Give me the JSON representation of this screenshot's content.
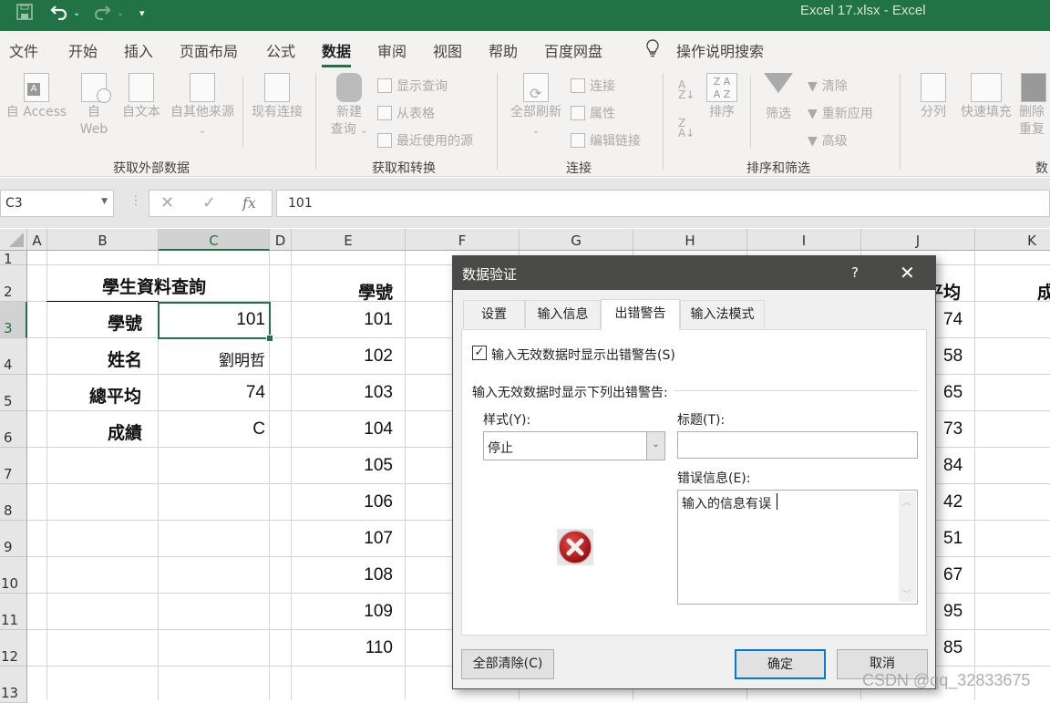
{
  "window": {
    "title": "Excel 17.xlsx  -  Excel"
  },
  "quick_access": {
    "save_icon": "save-icon",
    "undo_icon": "undo-icon",
    "redo_icon": "redo-icon",
    "customize_icon": "customize-qat-icon"
  },
  "ribbon_tabs": [
    {
      "label": "文件"
    },
    {
      "label": "开始"
    },
    {
      "label": "插入"
    },
    {
      "label": "页面布局"
    },
    {
      "label": "公式"
    },
    {
      "label": "数据",
      "active": true
    },
    {
      "label": "审阅"
    },
    {
      "label": "视图"
    },
    {
      "label": "帮助"
    },
    {
      "label": "百度网盘"
    }
  ],
  "tell_me": {
    "label": "操作说明搜索"
  },
  "ribbon": {
    "groups": [
      {
        "label": "获取外部数据",
        "buttons": [
          "自 Access",
          "自",
          "Web",
          "自文本",
          "自其他来源",
          "现有连接"
        ]
      },
      {
        "label": "获取和转换",
        "buttons": [
          "新建",
          "查询",
          "显示查询",
          "从表格",
          "最近使用的源"
        ]
      },
      {
        "label": "连接",
        "buttons": [
          "全部刷新",
          "连接",
          "属性",
          "编辑链接"
        ]
      },
      {
        "label": "排序和筛选",
        "buttons": [
          "排序",
          "筛选",
          "清除",
          "重新应用",
          "高级"
        ]
      },
      {
        "label": "数",
        "buttons": [
          "分列",
          "快速填充",
          "删除",
          "重复"
        ]
      }
    ]
  },
  "formula_bar": {
    "name_box": "C3",
    "value": "101",
    "fx": "fx"
  },
  "columns": [
    "A",
    "B",
    "C",
    "D",
    "E",
    "F",
    "G",
    "H",
    "I",
    "J",
    "K"
  ],
  "rows": [
    "1",
    "2",
    "3",
    "4",
    "5",
    "6",
    "7",
    "8",
    "9",
    "10",
    "11",
    "12",
    "13"
  ],
  "lookup": {
    "title": "學生資料查詢",
    "fields": [
      {
        "label": "學號",
        "value": "101"
      },
      {
        "label": "姓名",
        "value": "劉明哲"
      },
      {
        "label": "總平均",
        "value": "74"
      },
      {
        "label": "成績",
        "value": "C"
      }
    ]
  },
  "table": {
    "header_e": "學號",
    "header_j": "平均",
    "header_k": "成",
    "ids": [
      "101",
      "102",
      "103",
      "104",
      "105",
      "106",
      "107",
      "108",
      "109",
      "110"
    ],
    "averages": [
      "74",
      "58",
      "65",
      "73",
      "84",
      "42",
      "51",
      "67",
      "95",
      "85"
    ]
  },
  "dialog": {
    "title": "数据验证",
    "help": "?",
    "tabs": [
      "设置",
      "输入信息",
      "出错警告",
      "输入法模式"
    ],
    "active_tab": "出错警告",
    "show_alert_checkbox": {
      "label": "输入无效数据时显示出错警告(S)",
      "checked": true
    },
    "section_label": "输入无效数据时显示下列出错警告:",
    "style_label": "样式(Y):",
    "style_value": "停止",
    "title_label": "标题(T):",
    "title_value": "",
    "message_label": "错误信息(E):",
    "message_value": "输入的信息有误",
    "clear_all": "全部清除(C)",
    "ok": "确定",
    "cancel": "取消"
  },
  "watermark": "CSDN @qq_32833675"
}
